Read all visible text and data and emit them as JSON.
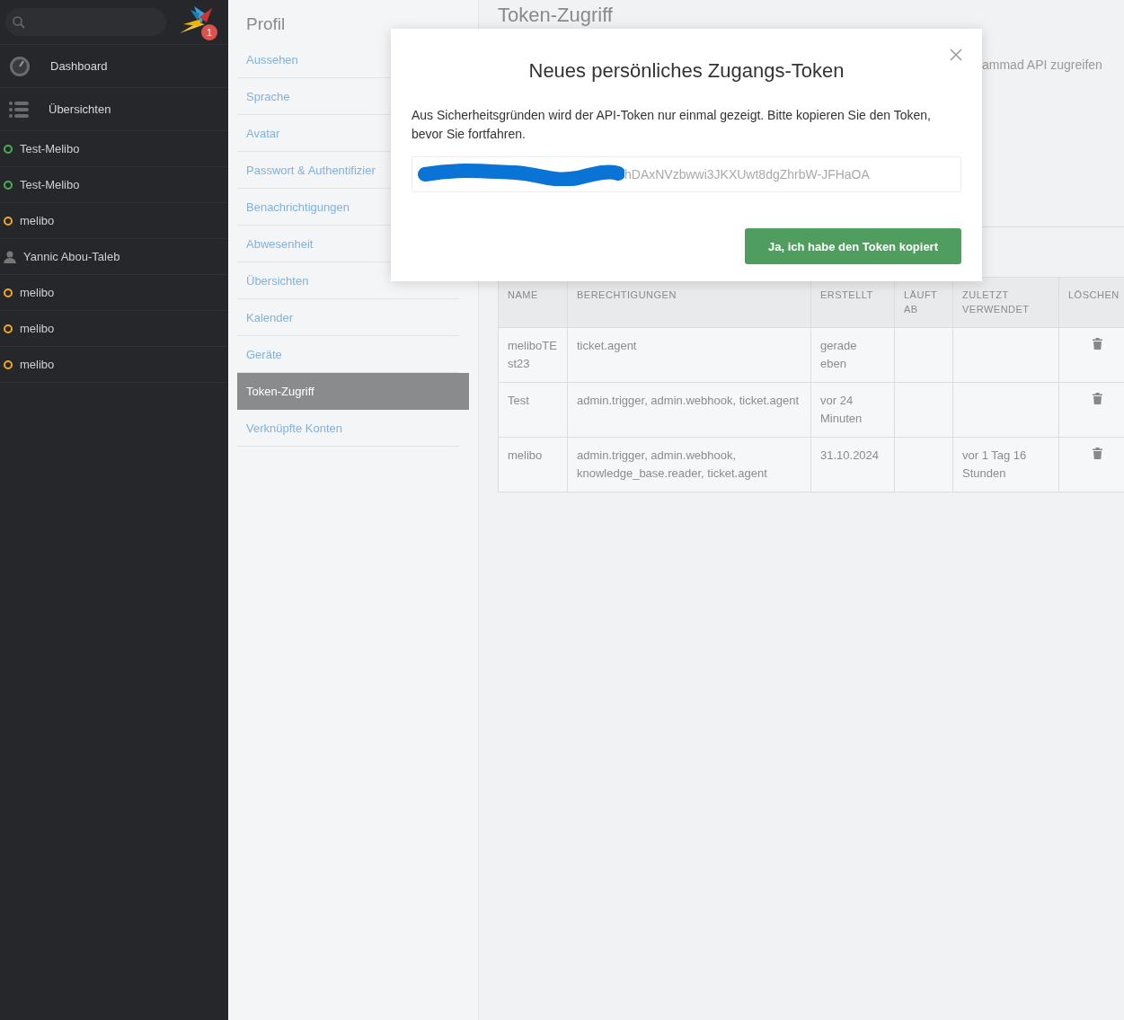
{
  "sidebar": {
    "notification_count": "1",
    "nav": [
      {
        "kind": "dashboard",
        "label": "Dashboard"
      },
      {
        "kind": "overviews",
        "label": "Übersichten"
      }
    ],
    "items": [
      {
        "kind": "status",
        "label": "Test-Melibo",
        "color": "#4caf50"
      },
      {
        "kind": "status",
        "label": "Test-Melibo",
        "color": "#4caf50"
      },
      {
        "kind": "status",
        "label": "melibo",
        "color": "#f5a623"
      },
      {
        "kind": "user",
        "label": "Yannic Abou-Taleb"
      },
      {
        "kind": "status",
        "label": "melibo",
        "color": "#f5a623"
      },
      {
        "kind": "status",
        "label": "melibo",
        "color": "#f5a623"
      },
      {
        "kind": "status",
        "label": "melibo",
        "color": "#f5a623"
      }
    ]
  },
  "profile_nav": {
    "title": "Profil",
    "items": [
      {
        "label": "Aussehen",
        "selected": false
      },
      {
        "label": "Sprache",
        "selected": false
      },
      {
        "label": "Avatar",
        "selected": false
      },
      {
        "label": "Passwort & Authentifizier",
        "selected": false
      },
      {
        "label": "Benachrichtigungen",
        "selected": false
      },
      {
        "label": "Abwesenheit",
        "selected": false
      },
      {
        "label": "Übersichten",
        "selected": false
      },
      {
        "label": "Kalender",
        "selected": false
      },
      {
        "label": "Geräte",
        "selected": false
      },
      {
        "label": "Token-Zugriff",
        "selected": true
      },
      {
        "label": "Verknüpfte Konten",
        "selected": false
      }
    ]
  },
  "page": {
    "title": "Token-Zugriff",
    "description": "ammad API zugreifen",
    "table": {
      "columns": [
        "NAME",
        "BERECHTIGUNGEN",
        "ERSTELLT",
        "LÄUFT AB",
        "ZULETZT VERWENDET",
        "LÖSCHEN"
      ],
      "rows": [
        {
          "name": "meliboTEst23",
          "permissions": "ticket.agent",
          "created": "gerade eben",
          "expires": "",
          "last_used": ""
        },
        {
          "name": "Test",
          "permissions": "admin.trigger, admin.webhook, ticket.agent",
          "created": "vor 24 Minuten",
          "expires": "",
          "last_used": ""
        },
        {
          "name": "melibo",
          "permissions": "admin.trigger, admin.webhook, knowledge_base.reader, ticket.agent",
          "created": "31.10.2024",
          "expires": "",
          "last_used": "vor 1 Tag 16 Stunden"
        }
      ]
    }
  },
  "modal": {
    "title": "Neues persönliches Zugangs-Token",
    "text": "Aus Sicherheitsgründen wird der API-Token nur einmal gezeigt. Bitte kopieren Sie den Token, bevor Sie fortfahren.",
    "token": "hDAxNVzbwwi3JKXUwt8dgZhrbW-JFHaOA",
    "button": "Ja, ich habe den Token kopiert"
  }
}
